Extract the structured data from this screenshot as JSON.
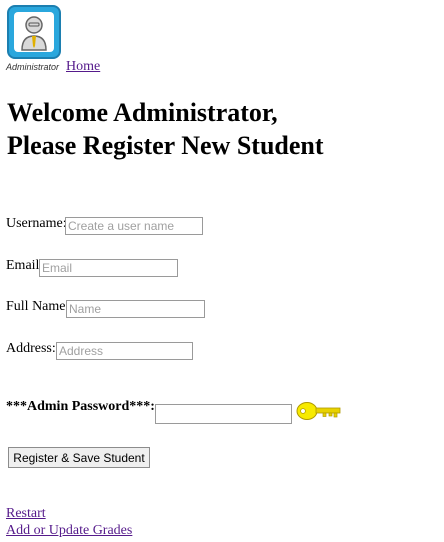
{
  "header": {
    "logo_caption": "Administrator",
    "home_link": "Home"
  },
  "title": {
    "line1": "Welcome Administrator,",
    "line2": "Please Register New Student"
  },
  "form": {
    "username": {
      "label": "Username:",
      "placeholder": "Create a user name",
      "value": ""
    },
    "email": {
      "label": "Email:",
      "placeholder": "Email",
      "value": ""
    },
    "fullname": {
      "label": "Full Name:",
      "placeholder": "Name",
      "value": ""
    },
    "address": {
      "label": "Address:",
      "placeholder": "Address",
      "value": ""
    },
    "admin_password": {
      "label": "***Admin Password***:",
      "value": ""
    },
    "submit_label": "Register & Save Student"
  },
  "links": {
    "restart": "Restart",
    "grades": "Add or Update Grades"
  },
  "icons": {
    "logo": "administrator-avatar-icon",
    "key": "key-icon"
  },
  "colors": {
    "logo_bg": "#2aa7dd",
    "link": "#551a8b",
    "key": "#f2e600"
  }
}
